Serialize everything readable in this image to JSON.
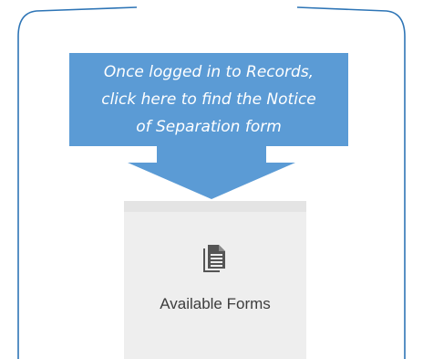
{
  "callout": {
    "lines": [
      "Once logged in to Records,",
      "click here to find the Notice",
      "of Separation form"
    ],
    "color": "#5b9bd5"
  },
  "card": {
    "icon": "documents-icon",
    "label": "Available Forms"
  },
  "frame_color": "#2e75b6"
}
